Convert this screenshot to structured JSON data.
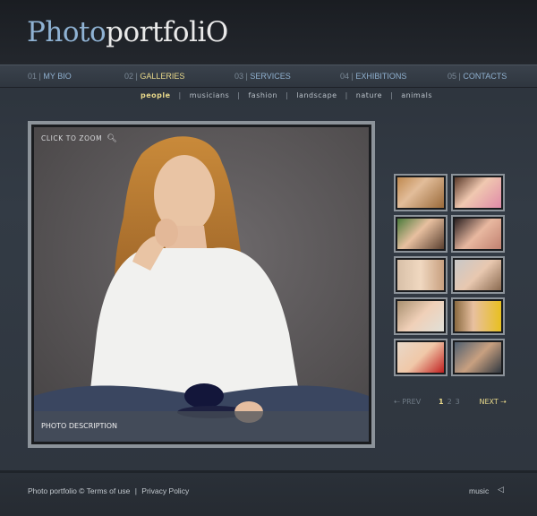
{
  "logo": {
    "part1": "Photo",
    "part2": "portfoliO"
  },
  "nav": [
    {
      "num": "01 |",
      "label": "MY BIO",
      "active": false
    },
    {
      "num": "02 |",
      "label": "GALLERIES",
      "active": true
    },
    {
      "num": "03 |",
      "label": "SERVICES",
      "active": false
    },
    {
      "num": "04 |",
      "label": "EXHIBITIONS",
      "active": false
    },
    {
      "num": "05 |",
      "label": "CONTACTS",
      "active": false
    }
  ],
  "subnav": [
    "people",
    "musicians",
    "fashion",
    "landscape",
    "nature",
    "animals"
  ],
  "photo": {
    "zoom_label": "CLICK TO ZOOM",
    "zoom_icon": "magnifier-icon",
    "description": "PHOTO DESCRIPTION"
  },
  "pager": {
    "prev": "PREV",
    "pages": [
      "1",
      "2",
      "3"
    ],
    "current": "1",
    "next": "NEXT"
  },
  "footer": {
    "copyright": "Photo portfolio ©",
    "terms": "Terms of use",
    "separator": "|",
    "privacy": "Privacy Policy",
    "music": "music",
    "speaker_icon": "speaker-icon"
  },
  "colors": {
    "accent": "#e8d88a",
    "nav_link": "#8fb0cf",
    "logo_blue": "#8fb2d3"
  }
}
